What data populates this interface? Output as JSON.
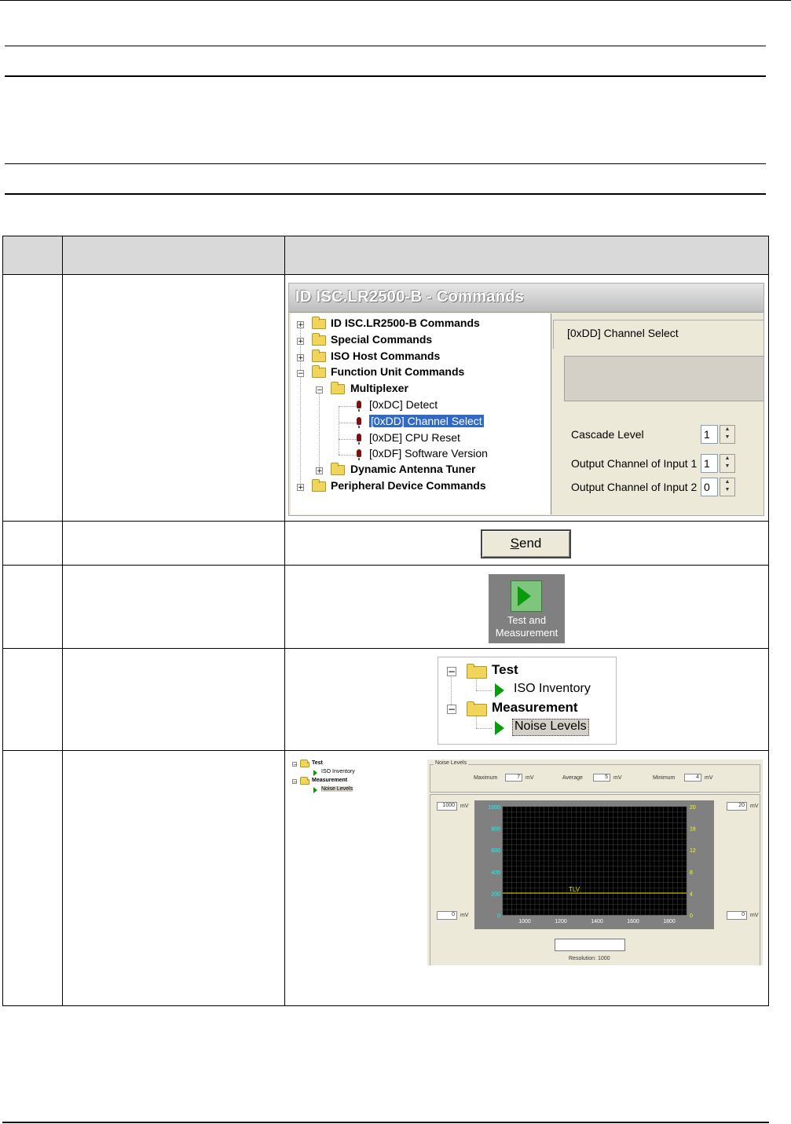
{
  "screenshot1": {
    "title": "ID ISC.LR2500-B - Commands",
    "tree": {
      "items": [
        {
          "label": "ID ISC.LR2500-B Commands",
          "expander": "+"
        },
        {
          "label": "Special Commands",
          "expander": "+"
        },
        {
          "label": "ISO Host Commands",
          "expander": "+"
        },
        {
          "label": "Function Unit Commands",
          "expander": "−"
        },
        {
          "label": "Multiplexer",
          "expander": "−"
        },
        {
          "label": "[0xDC] Detect"
        },
        {
          "label": "[0xDD] Channel Select"
        },
        {
          "label": "[0xDE] CPU Reset"
        },
        {
          "label": "[0xDF] Software Version"
        },
        {
          "label": "Dynamic Antenna Tuner",
          "expander": "+"
        },
        {
          "label": "Peripheral Device Commands",
          "expander": "+"
        }
      ]
    },
    "panel": {
      "command_name": "[0xDD] Channel Select",
      "fields": [
        {
          "label": "Cascade Level",
          "value": "1"
        },
        {
          "label": "Output Channel of Input 1",
          "value": "1"
        },
        {
          "label": "Output Channel of Input 2",
          "value": "0"
        }
      ]
    }
  },
  "send_button": {
    "label": "Send",
    "mnemonic": "S",
    "rest": "end"
  },
  "test_measurement": {
    "label_line1": "Test and",
    "label_line2": "Measurement"
  },
  "screenshot4": {
    "items": [
      {
        "label": "Test"
      },
      {
        "label": "ISO Inventory"
      },
      {
        "label": "Measurement"
      },
      {
        "label": "Noise Levels"
      }
    ]
  },
  "screenshot5": {
    "tree": [
      "Test",
      "ISO Inventory",
      "Measurement",
      "Noise Levels"
    ],
    "group_title": "Noise Levels",
    "stats": [
      {
        "label": "Maximum",
        "value": "7",
        "unit": "mV"
      },
      {
        "label": "Average",
        "value": "5",
        "unit": "mV"
      },
      {
        "label": "Minimum",
        "value": "4",
        "unit": "mV"
      }
    ],
    "left_max": "1000",
    "left_min": "0",
    "right_max": "20",
    "right_min": "0",
    "unit": "mV",
    "resolution": "Resolution: 1000",
    "y_left_ticks": [
      "1000",
      "800",
      "600",
      "400",
      "200",
      "0"
    ],
    "y_right_ticks": [
      "20",
      "16",
      "12",
      "8",
      "4",
      "0"
    ],
    "x_ticks": [
      "1000",
      "1200",
      "1400",
      "1600",
      "1800"
    ],
    "line_label": "TLV"
  }
}
